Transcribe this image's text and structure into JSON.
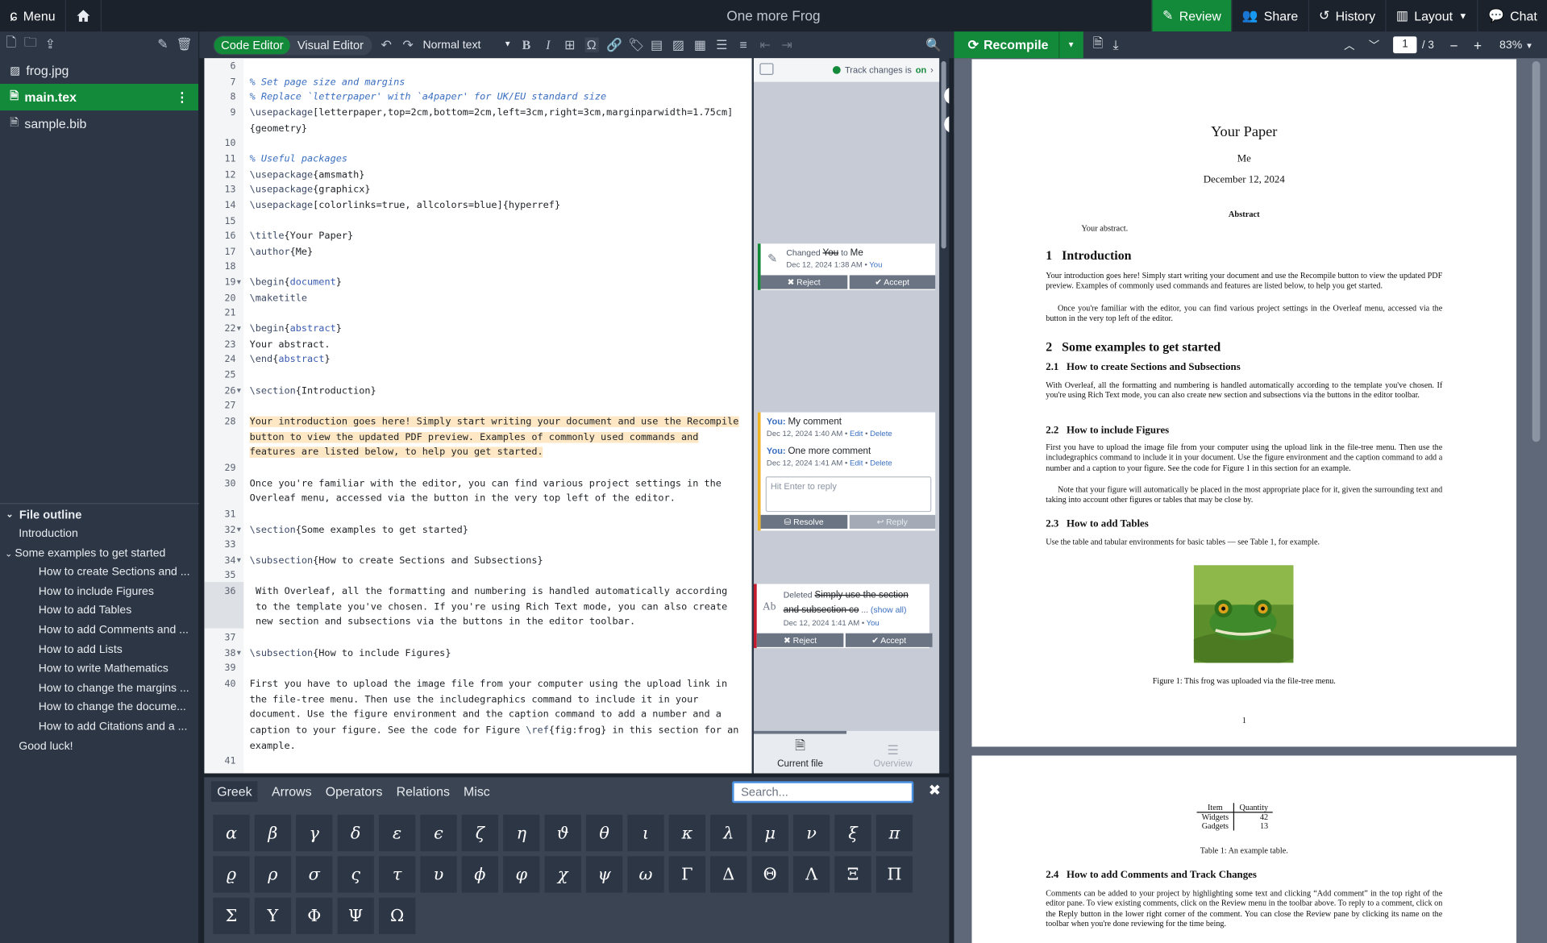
{
  "topbar": {
    "menu": "Menu",
    "title": "One more Frog",
    "review": "Review",
    "share": "Share",
    "history": "History",
    "layout": "Layout",
    "chat": "Chat"
  },
  "files": [
    {
      "name": "frog.jpg",
      "icon": "image-icon"
    },
    {
      "name": "main.tex",
      "icon": "file-icon",
      "active": true
    },
    {
      "name": "sample.bib",
      "icon": "file-icon"
    }
  ],
  "outline": {
    "title": "File outline",
    "items": [
      {
        "label": "Introduction",
        "level": 1
      },
      {
        "label": "Some examples to get started",
        "level": 1,
        "expanded": true
      },
      {
        "label": "How to create Sections and ...",
        "level": 2
      },
      {
        "label": "How to include Figures",
        "level": 2
      },
      {
        "label": "How to add Tables",
        "level": 2
      },
      {
        "label": "How to add Comments and ...",
        "level": 2
      },
      {
        "label": "How to add Lists",
        "level": 2
      },
      {
        "label": "How to write Mathematics",
        "level": 2
      },
      {
        "label": "How to change the margins ...",
        "level": 2
      },
      {
        "label": "How to change the docume...",
        "level": 2
      },
      {
        "label": "How to add Citations and a ...",
        "level": 2
      },
      {
        "label": "Good luck!",
        "level": 1
      }
    ]
  },
  "editor_toolbar": {
    "code_editor": "Code Editor",
    "visual_editor": "Visual Editor",
    "format": "Normal text"
  },
  "code": [
    {
      "n": "6",
      "t": []
    },
    {
      "n": "7",
      "t": [
        [
          "cmt",
          "% Set page size and margins"
        ]
      ]
    },
    {
      "n": "8",
      "t": [
        [
          "cmt",
          "% Replace `letterpaper' with `a4paper' for UK/EU standard size"
        ]
      ]
    },
    {
      "n": "9",
      "t": [
        [
          "cmd",
          "\\usepackage"
        ],
        [
          "",
          "[letterpaper,top=2cm,bottom=2cm,left=3cm,right=3cm,marginparwidth=1.75cm]"
        ]
      ]
    },
    {
      "n": "",
      "t": [
        [
          "",
          "{geometry}"
        ]
      ]
    },
    {
      "n": "10",
      "t": []
    },
    {
      "n": "11",
      "t": [
        [
          "cmt",
          "% Useful packages"
        ]
      ]
    },
    {
      "n": "12",
      "t": [
        [
          "cmd",
          "\\usepackage"
        ],
        [
          "",
          "{amsmath}"
        ]
      ]
    },
    {
      "n": "13",
      "t": [
        [
          "cmd",
          "\\usepackage"
        ],
        [
          "",
          "{graphicx}"
        ]
      ]
    },
    {
      "n": "14",
      "t": [
        [
          "cmd",
          "\\usepackage"
        ],
        [
          "",
          "[colorlinks=true, allcolors=blue]{hyperref}"
        ]
      ]
    },
    {
      "n": "15",
      "t": []
    },
    {
      "n": "16",
      "t": [
        [
          "cmd",
          "\\title"
        ],
        [
          "",
          "{Your Paper}"
        ]
      ]
    },
    {
      "n": "17",
      "t": [
        [
          "cmd",
          "\\author"
        ],
        [
          "",
          "{Me}"
        ]
      ]
    },
    {
      "n": "18",
      "t": []
    },
    {
      "n": "19",
      "a": true,
      "t": [
        [
          "cmd",
          "\\begin"
        ],
        [
          "",
          "{"
        ],
        [
          "kw",
          "document"
        ],
        [
          "",
          "}"
        ]
      ]
    },
    {
      "n": "20",
      "t": [
        [
          "cmd",
          "\\maketitle"
        ]
      ]
    },
    {
      "n": "21",
      "t": []
    },
    {
      "n": "22",
      "a": true,
      "t": [
        [
          "cmd",
          "\\begin"
        ],
        [
          "",
          "{"
        ],
        [
          "kw",
          "abstract"
        ],
        [
          "",
          "}"
        ]
      ]
    },
    {
      "n": "23",
      "t": [
        [
          "",
          "Your abstract."
        ]
      ]
    },
    {
      "n": "24",
      "t": [
        [
          "cmd",
          "\\end"
        ],
        [
          "",
          "{"
        ],
        [
          "kw",
          "abstract"
        ],
        [
          "",
          "}"
        ]
      ]
    },
    {
      "n": "25",
      "t": []
    },
    {
      "n": "26",
      "a": true,
      "t": [
        [
          "cmd",
          "\\section"
        ],
        [
          "",
          "{Introduction}"
        ]
      ]
    },
    {
      "n": "27",
      "t": []
    },
    {
      "n": "28",
      "t": [
        [
          "hl-chg",
          "Your introduction goes here! Simply start writing your document and use the Recompile"
        ]
      ]
    },
    {
      "n": "",
      "t": [
        [
          "hl-chg",
          "button to view the updated PDF preview. Examples of commonly used commands and"
        ]
      ]
    },
    {
      "n": "",
      "t": [
        [
          "hl-chg",
          "features are listed below, to help you get started."
        ]
      ]
    },
    {
      "n": "29",
      "t": []
    },
    {
      "n": "30",
      "t": [
        [
          "",
          "Once you're familiar with the editor, you can find various project settings in the"
        ]
      ]
    },
    {
      "n": "",
      "t": [
        [
          "",
          "Overleaf menu, accessed via the button in the very top left of the editor."
        ]
      ]
    },
    {
      "n": "31",
      "t": []
    },
    {
      "n": "32",
      "a": true,
      "t": [
        [
          "cmd",
          "\\section"
        ],
        [
          "",
          "{Some examples to get started}"
        ]
      ]
    },
    {
      "n": "33",
      "t": []
    },
    {
      "n": "34",
      "a": true,
      "t": [
        [
          "cmd",
          "\\subsection"
        ],
        [
          "",
          "{How to create Sections and Subsections}"
        ]
      ]
    },
    {
      "n": "35",
      "t": []
    },
    {
      "n": "36",
      "g": true,
      "t": [
        [
          "",
          "With Overleaf, all the formatting and numbering is handled automatically according"
        ]
      ]
    },
    {
      "n": "",
      "g": true,
      "t": [
        [
          "",
          "to the template you've chosen. If you're using Rich Text mode, you can also create"
        ]
      ]
    },
    {
      "n": "",
      "g": true,
      "t": [
        [
          "",
          "new section and subsections via the buttons in the editor toolbar."
        ]
      ]
    },
    {
      "n": "37",
      "t": []
    },
    {
      "n": "38",
      "a": true,
      "t": [
        [
          "cmd",
          "\\subsection"
        ],
        [
          "",
          "{How to include Figures}"
        ]
      ]
    },
    {
      "n": "39",
      "t": []
    },
    {
      "n": "40",
      "t": [
        [
          "",
          "First you have to upload the image file from your computer using the upload link in"
        ]
      ]
    },
    {
      "n": "",
      "t": [
        [
          "",
          "the file-tree menu. Then use the includegraphics command to include it in your"
        ]
      ]
    },
    {
      "n": "",
      "t": [
        [
          "",
          "document. Use the figure environment and the caption command to add a number and a"
        ]
      ]
    },
    {
      "n": "",
      "t": [
        [
          "",
          "caption to your figure. See the code for Figure "
        ],
        [
          "cmd",
          "\\ref"
        ],
        [
          "",
          "{fig:frog} in this section for an"
        ]
      ]
    },
    {
      "n": "",
      "t": [
        [
          "",
          "example."
        ]
      ]
    },
    {
      "n": "41",
      "t": []
    }
  ],
  "review": {
    "track_label": "Track changes is",
    "track_state": "on",
    "change1": {
      "verb": "Changed",
      "old": "You",
      "to": "to",
      "new": "Me",
      "meta": "Dec 12, 2024 1:38 AM • ",
      "user": "You",
      "reject": "✖ Reject",
      "accept": "✔ Accept"
    },
    "comments": [
      {
        "user": "You:",
        "text": "My comment",
        "meta": "Dec 12, 2024 1:40 AM • ",
        "edit": "Edit",
        "delete": "Delete"
      },
      {
        "user": "You:",
        "text": "One more comment",
        "meta": "Dec 12, 2024 1:41 AM • ",
        "edit": "Edit",
        "delete": "Delete"
      }
    ],
    "reply_placeholder": "Hit Enter to reply",
    "resolve": "Resolve",
    "reply": "Reply",
    "change2": {
      "verb": "Deleted",
      "deleted": "Simply use the section and subsection co",
      "more": "(show all)",
      "meta": "Dec 12, 2024 1:41 AM • ",
      "user": "You",
      "reject": "✖ Reject",
      "accept": "✔ Accept"
    },
    "tabs": {
      "current": "Current file",
      "overview": "Overview"
    }
  },
  "symbols": {
    "tabs": [
      "Greek",
      "Arrows",
      "Operators",
      "Relations",
      "Misc"
    ],
    "search_placeholder": "Search...",
    "items": [
      "α",
      "β",
      "γ",
      "δ",
      "ε",
      "ϵ",
      "ζ",
      "η",
      "ϑ",
      "θ",
      "ι",
      "κ",
      "λ",
      "μ",
      "ν",
      "ξ",
      "π",
      "ϱ",
      "ρ",
      "σ",
      "ς",
      "τ",
      "υ",
      "ϕ",
      "φ",
      "χ",
      "ψ",
      "ω",
      "Γ",
      "Δ",
      "Θ",
      "Λ",
      "Ξ",
      "Π",
      "Σ",
      "Υ",
      "Φ",
      "Ψ",
      "Ω"
    ]
  },
  "pdf": {
    "recompile": "Recompile",
    "page": "1",
    "total": "/ 3",
    "zoom": "83%",
    "title": "Your Paper",
    "author": "Me",
    "date": "December 12, 2024",
    "abstract_h": "Abstract",
    "abstract": "Your abstract.",
    "s1": "1   Introduction",
    "p1": "Your introduction goes here! Simply start writing your document and use the Recompile button to view the updated PDF preview. Examples of commonly used commands and features are listed below, to help you get started.",
    "p2": "Once you're familiar with the editor, you can find various project settings in the Overleaf menu, accessed via the button in the very top left of the editor.",
    "s2": "2   Some examples to get started",
    "s21": "2.1   How to create Sections and Subsections",
    "p3": "With Overleaf, all the formatting and numbering is handled automatically according to the template you've chosen. If you're using Rich Text mode, you can also create new section and subsections via the buttons in the editor toolbar.",
    "s22": "2.2   How to include Figures",
    "p4": "First you have to upload the image file from your computer using the upload link in the file-tree menu. Then use the includegraphics command to include it in your document. Use the figure environment and the caption command to add a number and a caption to your figure. See the code for Figure 1 in this section for an example.",
    "p5": "Note that your figure will automatically be placed in the most appropriate place for it, given the surrounding text and taking into account other figures or tables that may be close by.",
    "s23": "2.3   How to add Tables",
    "p6": "Use the table and tabular environments for basic tables — see Table 1, for example.",
    "fig_caption": "Figure 1: This frog was uploaded via the file-tree menu.",
    "pagenum": "1",
    "table_head": [
      "Item",
      "Quantity"
    ],
    "table_rows": [
      [
        "Widgets",
        "42"
      ],
      [
        "Gadgets",
        "13"
      ]
    ],
    "table_caption": "Table 1: An example table.",
    "s24": "2.4   How to add Comments and Track Changes",
    "p7": "Comments can be added to your project by highlighting some text and clicking “Add comment” in the top right of the editor pane. To view existing comments, click on the Review menu in the toolbar above. To reply to a comment, click on the Reply button in the lower right corner of the comment. You can close the Review pane by clicking its name on the toolbar when you're done reviewing for the time being."
  }
}
